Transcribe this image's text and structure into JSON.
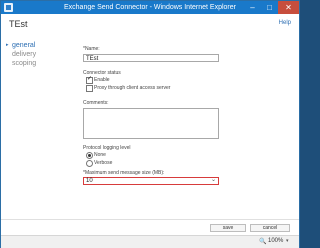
{
  "window": {
    "title": "Exchange Send Connector - Windows Internet Explorer"
  },
  "header": {
    "title": "TEst",
    "help": "Help"
  },
  "nav": {
    "items": [
      "general",
      "delivery",
      "scoping"
    ]
  },
  "form": {
    "name_label": "*Name:",
    "name_value": "TEst",
    "connector_status_label": "Connector status",
    "enable_label": "Enable",
    "proxy_label": "Proxy through client access server",
    "comments_label": "Comments:",
    "protocol_label": "Protocol logging level",
    "none_label": "None",
    "verbose_label": "Verbose",
    "max_size_label": "*Maximum send message size (MB):",
    "max_size_value": "10"
  },
  "footer": {
    "save": "save",
    "cancel": "cancel"
  },
  "status": {
    "zoom": "100%"
  }
}
